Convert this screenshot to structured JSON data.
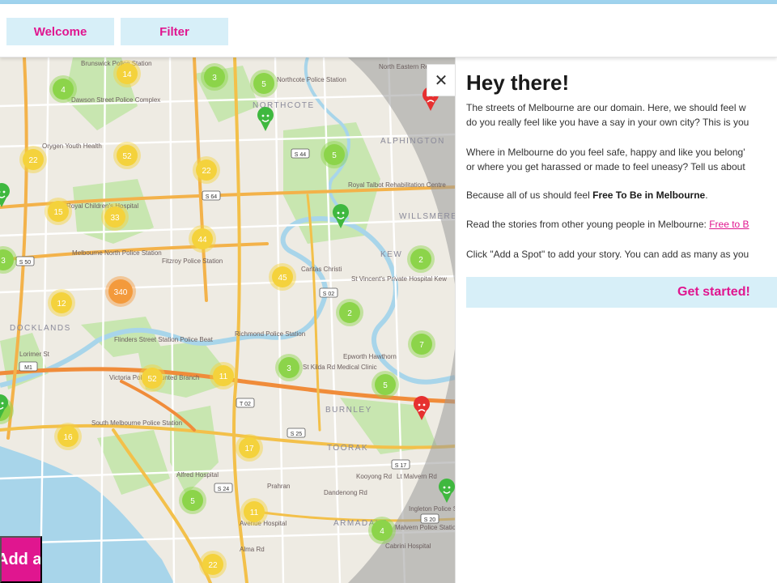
{
  "nav": {
    "welcome_label": "Welcome",
    "filter_label": "Filter"
  },
  "panel": {
    "close_glyph": "✕",
    "title": "Hey there!",
    "para1_line1": "The streets of Melbourne are our domain. Here, we should feel w",
    "para1_line2": "do you really feel like you have a say in your own city? This is you",
    "para2_line1": "Where in Melbourne do you feel safe, happy and like you belong'",
    "para2_line2": "or where you get harassed or made to feel uneasy? Tell us about",
    "para3_prefix": "Because all of us should feel ",
    "para3_bold": "Free To Be in Melbourne",
    "para3_suffix": ".",
    "para4_prefix": "Read the stories from other young people in Melbourne: ",
    "para4_link": "Free to B",
    "para5": "Click \"Add a Spot\" to add your story. You can add as many as you",
    "cta_label": "Get started!"
  },
  "add_spot_label": "Add a Spot",
  "colors": {
    "accent": "#e0168f",
    "button_bg": "#d7eff8",
    "cluster_yellow": "#f4d23c",
    "cluster_green": "#8cd44a",
    "cluster_orange": "#f39a3c",
    "smile_green": "#3fb83f",
    "frown_red": "#e63030"
  },
  "map": {
    "clusters": [
      {
        "count": "14",
        "color": "yellow"
      },
      {
        "count": "4",
        "color": "green"
      },
      {
        "count": "3",
        "color": "green"
      },
      {
        "count": "5",
        "color": "green"
      },
      {
        "count": "22",
        "color": "yellow"
      },
      {
        "count": "52",
        "color": "yellow"
      },
      {
        "count": "22",
        "color": "yellow"
      },
      {
        "count": "5",
        "color": "green"
      },
      {
        "count": "15",
        "color": "yellow"
      },
      {
        "count": "33",
        "color": "yellow"
      },
      {
        "count": "44",
        "color": "yellow"
      },
      {
        "count": "340",
        "color": "orange"
      },
      {
        "count": "12",
        "color": "yellow"
      },
      {
        "count": "45",
        "color": "yellow"
      },
      {
        "count": "2",
        "color": "green"
      },
      {
        "count": "2",
        "color": "green"
      },
      {
        "count": "7",
        "color": "green"
      },
      {
        "count": "3",
        "color": "green"
      },
      {
        "count": "52",
        "color": "yellow"
      },
      {
        "count": "11",
        "color": "yellow"
      },
      {
        "count": "5",
        "color": "green"
      },
      {
        "count": "16",
        "color": "yellow"
      },
      {
        "count": "17",
        "color": "yellow"
      },
      {
        "count": "5",
        "color": "green"
      },
      {
        "count": "11",
        "color": "yellow"
      },
      {
        "count": "4",
        "color": "green"
      },
      {
        "count": "22",
        "color": "yellow"
      },
      {
        "count": "3",
        "color": "green"
      },
      {
        "count": "3",
        "color": "green"
      }
    ],
    "labels": [
      "Brunswick Police Station",
      "Dawson Street Police Complex",
      "NORTHCOTE",
      "Northcote Police Station",
      "North Eastern Rehabilitation Centre",
      "ALPHINGTON",
      "Orygen Youth Health",
      "Royal Talbot Rehabilitation Centre",
      "WILLSMERE",
      "Royal Children's Hospital",
      "Melbourne North Police Station",
      "Fitzroy Police Station",
      "Caritas Christi",
      "St Vincent's Private Hospital Kew",
      "KEW",
      "DOCKLANDS",
      "Flinders Street Station Police Beat",
      "Richmond Police Station",
      "Epworth Hawthorn",
      "Victoria Police Mounted Branch",
      "Lorimer St",
      "South Melbourne Police Station",
      "St Kilda Rd Medical Clinic",
      "BURNLEY",
      "TOORAK",
      "Alfred Hospital",
      "Prahran",
      "Avenue Hospital",
      "ARMADALE",
      "Malvern Police Station",
      "Cabrini Hospital",
      "Alma Rd",
      "Kooyong Rd",
      "Dandenong Rd",
      "Ingleton Police Station",
      "Lt Malvern Rd"
    ],
    "road_shields": [
      "S 44",
      "S 64",
      "S 50",
      "S 02",
      "S 25",
      "S 24",
      "S 17",
      "S 20",
      "T 02",
      "M1"
    ],
    "smile_markers": [
      "smile",
      "smile",
      "smile",
      "smile",
      "smile"
    ],
    "frown_markers": [
      "frown",
      "frown"
    ]
  }
}
